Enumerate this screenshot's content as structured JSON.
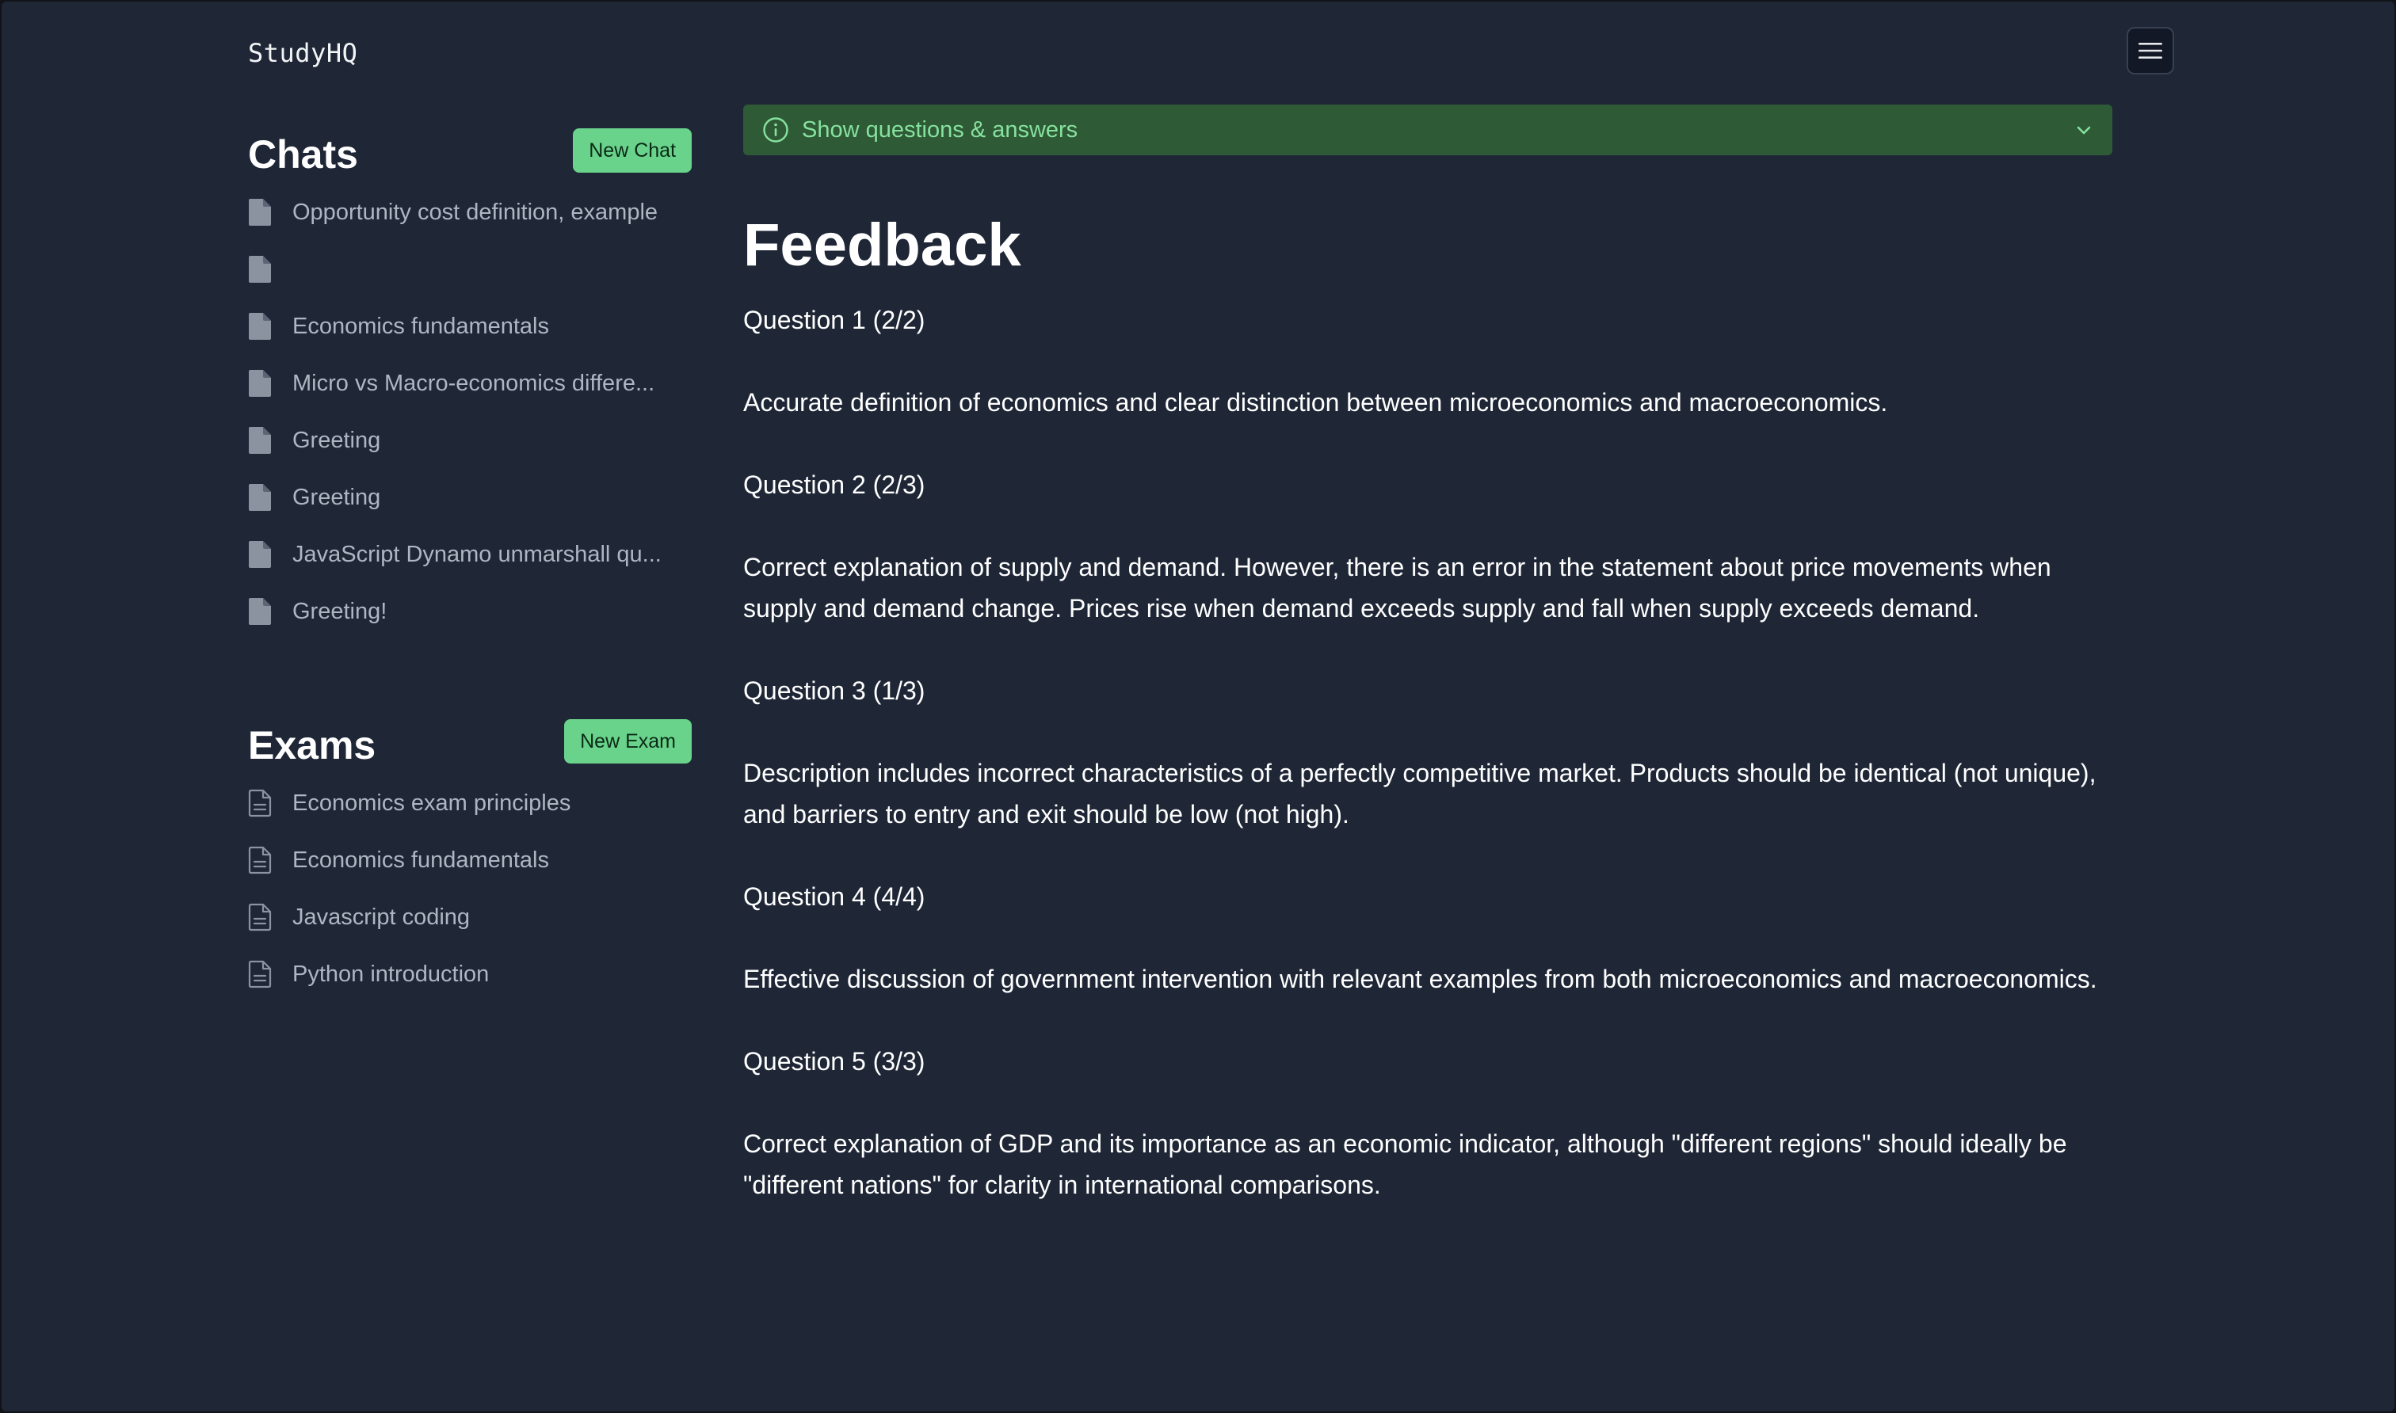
{
  "app": {
    "logo": "StudyHQ"
  },
  "sidebar": {
    "chats": {
      "title": "Chats",
      "new_button": "New Chat",
      "items": [
        {
          "label": "Opportunity cost definition, example"
        },
        {
          "label": ""
        },
        {
          "label": "Economics fundamentals"
        },
        {
          "label": "Micro vs Macro-economics differe..."
        },
        {
          "label": "Greeting"
        },
        {
          "label": "Greeting"
        },
        {
          "label": "JavaScript Dynamo unmarshall qu..."
        },
        {
          "label": "Greeting!"
        }
      ]
    },
    "exams": {
      "title": "Exams",
      "new_button": "New Exam",
      "items": [
        {
          "label": "Economics exam principles"
        },
        {
          "label": "Economics fundamentals"
        },
        {
          "label": "Javascript coding"
        },
        {
          "label": "Python introduction"
        }
      ]
    }
  },
  "main": {
    "qa_toggle": "Show questions & answers",
    "title": "Feedback",
    "feedback": [
      {
        "heading": "Question 1 (2/2)",
        "text": "Accurate definition of economics and clear distinction between microeconomics and macroeconomics."
      },
      {
        "heading": "Question 2 (2/3)",
        "text": "Correct explanation of supply and demand. However, there is an error in the statement about price movements when supply and demand change. Prices rise when demand exceeds supply and fall when supply exceeds demand."
      },
      {
        "heading": "Question 3 (1/3)",
        "text": "Description includes incorrect characteristics of a perfectly competitive market. Products should be identical (not unique), and barriers to entry and exit should be low (not high)."
      },
      {
        "heading": "Question 4 (4/4)",
        "text": "Effective discussion of government intervention with relevant examples from both microeconomics and macroeconomics."
      },
      {
        "heading": "Question 5 (3/3)",
        "text": "Correct explanation of GDP and its importance as an economic indicator, although \"different regions\" should ideally be \"different nations\" for clarity in international comparisons."
      }
    ]
  },
  "colors": {
    "background": "#1f2737",
    "accent_button": "#6ad38b",
    "banner_bg": "#2f5a36",
    "banner_text": "#86e29f",
    "sidebar_text": "#aeb6c3"
  },
  "icons": {
    "menu": "hamburger-menu-icon",
    "info": "info-icon",
    "chevron": "chevron-down-icon",
    "chat_item": "document-filled-icon",
    "exam_item": "document-outline-icon"
  }
}
